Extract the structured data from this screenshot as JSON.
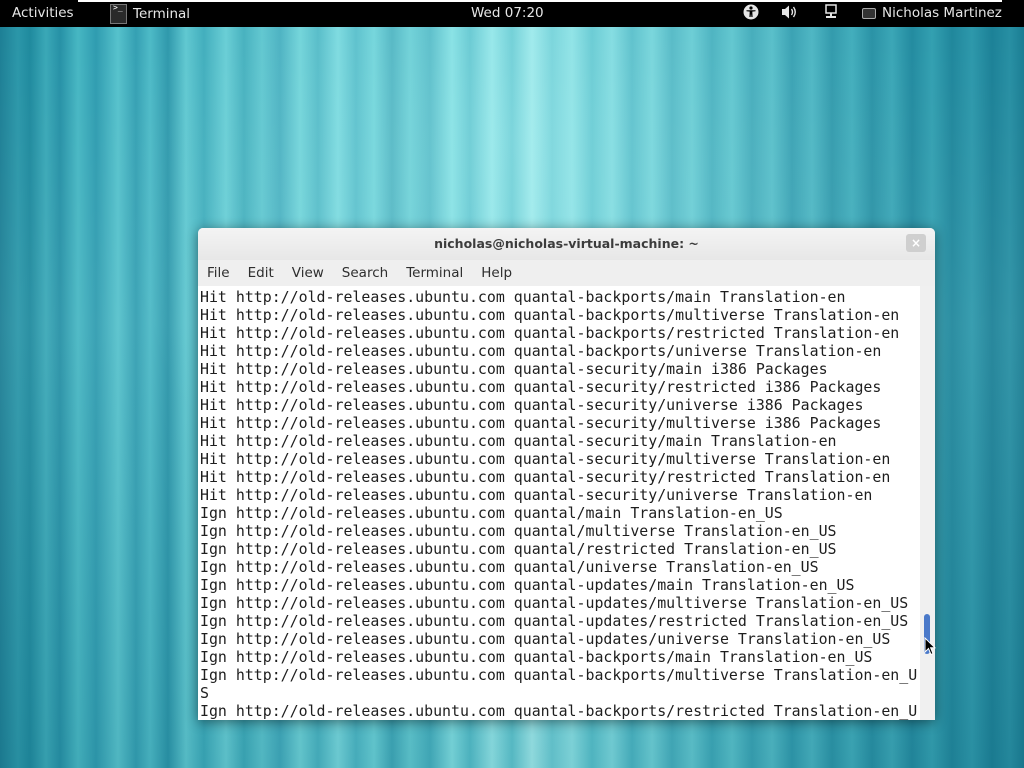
{
  "top_panel": {
    "activities_label": "Activities",
    "app_name": "Terminal",
    "clock": "Wed 07:20",
    "user_name": "Nicholas Martinez",
    "icons": [
      "terminal-app-icon",
      "accessibility-icon",
      "volume-icon",
      "network-icon",
      "chat-status-icon"
    ]
  },
  "window": {
    "title": "nicholas@nicholas-virtual-machine: ~",
    "close_label": "×",
    "menu": [
      "File",
      "Edit",
      "View",
      "Search",
      "Terminal",
      "Help"
    ]
  },
  "terminal": {
    "lines": [
      "Hit http://old-releases.ubuntu.com quantal-backports/main Translation-en",
      "Hit http://old-releases.ubuntu.com quantal-backports/multiverse Translation-en",
      "Hit http://old-releases.ubuntu.com quantal-backports/restricted Translation-en",
      "Hit http://old-releases.ubuntu.com quantal-backports/universe Translation-en",
      "Hit http://old-releases.ubuntu.com quantal-security/main i386 Packages",
      "Hit http://old-releases.ubuntu.com quantal-security/restricted i386 Packages",
      "Hit http://old-releases.ubuntu.com quantal-security/universe i386 Packages",
      "Hit http://old-releases.ubuntu.com quantal-security/multiverse i386 Packages",
      "Hit http://old-releases.ubuntu.com quantal-security/main Translation-en",
      "Hit http://old-releases.ubuntu.com quantal-security/multiverse Translation-en",
      "Hit http://old-releases.ubuntu.com quantal-security/restricted Translation-en",
      "Hit http://old-releases.ubuntu.com quantal-security/universe Translation-en",
      "Ign http://old-releases.ubuntu.com quantal/main Translation-en_US",
      "Ign http://old-releases.ubuntu.com quantal/multiverse Translation-en_US",
      "Ign http://old-releases.ubuntu.com quantal/restricted Translation-en_US",
      "Ign http://old-releases.ubuntu.com quantal/universe Translation-en_US",
      "Ign http://old-releases.ubuntu.com quantal-updates/main Translation-en_US",
      "Ign http://old-releases.ubuntu.com quantal-updates/multiverse Translation-en_US",
      "Ign http://old-releases.ubuntu.com quantal-updates/restricted Translation-en_US",
      "Ign http://old-releases.ubuntu.com quantal-updates/universe Translation-en_US",
      "Ign http://old-releases.ubuntu.com quantal-backports/main Translation-en_US",
      "Ign http://old-releases.ubuntu.com quantal-backports/multiverse Translation-en_U",
      "S",
      "Ign http://old-releases.ubuntu.com quantal-backports/restricted Translation-en_U"
    ]
  },
  "colors": {
    "panel_bg": "#000000",
    "scroll_thumb": "#4a79c9",
    "terminal_bg": "#ffffff"
  }
}
